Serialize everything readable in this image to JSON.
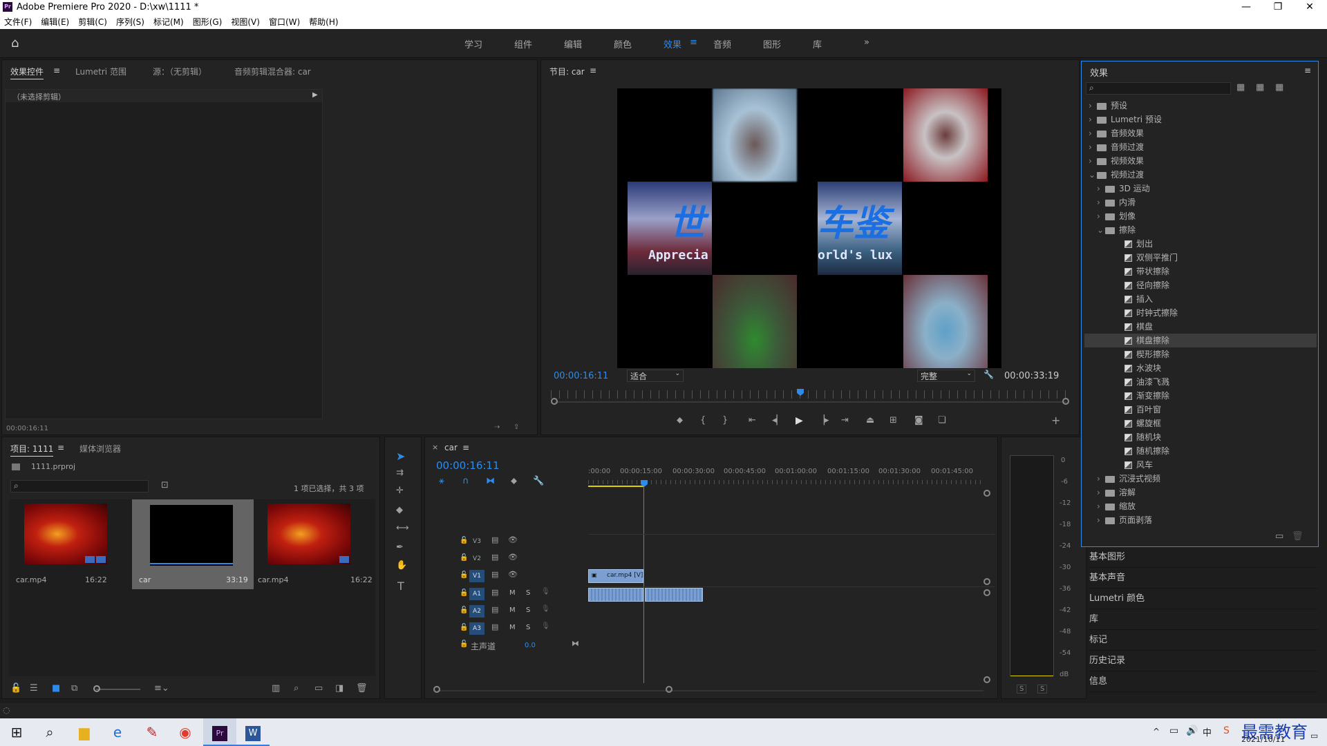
{
  "window": {
    "title": "Adobe Premiere Pro 2020 - D:\\xw\\1111 *",
    "app_badge": "Pr"
  },
  "menu": [
    "文件(F)",
    "编辑(E)",
    "剪辑(C)",
    "序列(S)",
    "标记(M)",
    "图形(G)",
    "视图(V)",
    "窗口(W)",
    "帮助(H)"
  ],
  "workspaces": [
    "学习",
    "组件",
    "编辑",
    "颜色",
    "效果",
    "音频",
    "图形",
    "库"
  ],
  "workspace_active": "效果",
  "effect_controls": {
    "tabs": [
      "效果控件",
      "Lumetri 范围",
      "源：（无剪辑）",
      "音频剪辑混合器: car"
    ],
    "no_clip": "（未选择剪辑）",
    "timecode": "00:00:16:11"
  },
  "program": {
    "title": "节目: car",
    "timecode_current": "00:00:16:11",
    "fit": "适合",
    "quality": "完整",
    "timecode_duration": "00:00:33:19",
    "overlay_text_1": "世",
    "overlay_text_2": "Apprecia",
    "overlay_text_3": "车鉴",
    "overlay_text_4": "orld's lux"
  },
  "project": {
    "tabs": [
      "项目: 1111",
      "媒体浏览器"
    ],
    "file": "1111.prproj",
    "selection": "1 项已选择，共 3 项",
    "items": [
      {
        "name": "car.mp4",
        "duration": "16:22"
      },
      {
        "name": "car",
        "duration": "33:19"
      },
      {
        "name": "car.mp4",
        "duration": "16:22"
      }
    ]
  },
  "timeline": {
    "seq_name": "car",
    "timecode": "00:00:16:11",
    "ruler": [
      ":00:00",
      "00:00:15:00",
      "00:00:30:00",
      "00:00:45:00",
      "00:01:00:00",
      "00:01:15:00",
      "00:01:30:00",
      "00:01:45:00"
    ],
    "video_tracks": [
      "V3",
      "V2",
      "V1"
    ],
    "audio_tracks": [
      "A1",
      "A2",
      "A3"
    ],
    "master_label": "主声道",
    "master_value": "0.0",
    "clip_v1": "car.mp4 [V]",
    "track_m": "M",
    "track_s": "S"
  },
  "meter": {
    "scale": [
      "0",
      "-6",
      "-12",
      "-18",
      "-24",
      "-30",
      "-36",
      "-42",
      "-48",
      "-54",
      "dB"
    ],
    "solo": [
      "S",
      "S"
    ]
  },
  "effects": {
    "title": "效果",
    "tree": [
      {
        "label": "预设",
        "level": 0,
        "type": "folder",
        "open": false
      },
      {
        "label": "Lumetri 预设",
        "level": 0,
        "type": "folder",
        "open": false
      },
      {
        "label": "音频效果",
        "level": 0,
        "type": "folder",
        "open": false
      },
      {
        "label": "音频过渡",
        "level": 0,
        "type": "folder",
        "open": false
      },
      {
        "label": "视频效果",
        "level": 0,
        "type": "folder",
        "open": false
      },
      {
        "label": "视频过渡",
        "level": 0,
        "type": "folder",
        "open": true
      },
      {
        "label": "3D 运动",
        "level": 1,
        "type": "folder",
        "open": false
      },
      {
        "label": "内滑",
        "level": 1,
        "type": "folder",
        "open": false
      },
      {
        "label": "划像",
        "level": 1,
        "type": "folder",
        "open": false
      },
      {
        "label": "擦除",
        "level": 1,
        "type": "folder",
        "open": true
      },
      {
        "label": "划出",
        "level": 2,
        "type": "fx"
      },
      {
        "label": "双侧平推门",
        "level": 2,
        "type": "fx"
      },
      {
        "label": "带状擦除",
        "level": 2,
        "type": "fx"
      },
      {
        "label": "径向擦除",
        "level": 2,
        "type": "fx"
      },
      {
        "label": "插入",
        "level": 2,
        "type": "fx"
      },
      {
        "label": "时钟式擦除",
        "level": 2,
        "type": "fx"
      },
      {
        "label": "棋盘",
        "level": 2,
        "type": "fx"
      },
      {
        "label": "棋盘擦除",
        "level": 2,
        "type": "fx",
        "selected": true
      },
      {
        "label": "楔形擦除",
        "level": 2,
        "type": "fx"
      },
      {
        "label": "水波块",
        "level": 2,
        "type": "fx"
      },
      {
        "label": "油漆飞溅",
        "level": 2,
        "type": "fx"
      },
      {
        "label": "渐变擦除",
        "level": 2,
        "type": "fx"
      },
      {
        "label": "百叶窗",
        "level": 2,
        "type": "fx"
      },
      {
        "label": "螺旋框",
        "level": 2,
        "type": "fx"
      },
      {
        "label": "随机块",
        "level": 2,
        "type": "fx"
      },
      {
        "label": "随机擦除",
        "level": 2,
        "type": "fx"
      },
      {
        "label": "风车",
        "level": 2,
        "type": "fx"
      },
      {
        "label": "沉浸式视频",
        "level": 1,
        "type": "folder",
        "open": false
      },
      {
        "label": "溶解",
        "level": 1,
        "type": "folder",
        "open": false
      },
      {
        "label": "缩放",
        "level": 1,
        "type": "folder",
        "open": false
      },
      {
        "label": "页面剥落",
        "level": 1,
        "type": "folder",
        "open": false
      }
    ]
  },
  "side_panels": [
    "基本图形",
    "基本声音",
    "Lumetri 颜色",
    "库",
    "标记",
    "历史记录",
    "信息"
  ],
  "taskbar": {
    "ime": "中",
    "date": "2021/10/11",
    "watermark": "最需教育"
  },
  "colors": {
    "accent": "#2d8ceb",
    "clip": "#7a9fd0",
    "panel": "#232323"
  }
}
